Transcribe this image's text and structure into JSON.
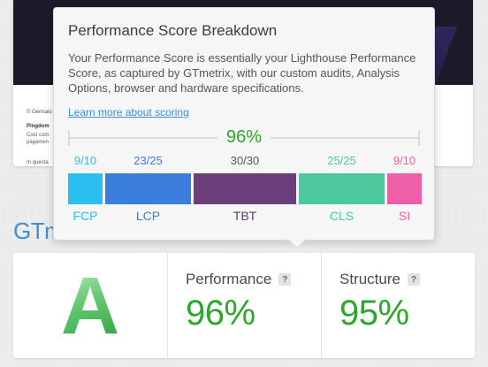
{
  "tooltip": {
    "title": "Performance Score Breakdown",
    "description": "Your Performance Score is essentially your Lighthouse Performance Score, as captured by GTmetrix, with our custom audits, Analysis Options, browser and hardware specifications.",
    "link_label": "Learn more about scoring",
    "total_score": "96%",
    "segments": [
      {
        "key": "fcp",
        "name": "FCP",
        "points": "9/10",
        "color": "#2bbff0",
        "weight": 10,
        "earned": 9
      },
      {
        "key": "lcp",
        "name": "LCP",
        "points": "23/25",
        "color": "#3a7ddb",
        "weight": 25,
        "earned": 23
      },
      {
        "key": "tbt",
        "name": "TBT",
        "points": "30/30",
        "color": "#6b3f7a",
        "weight": 30,
        "earned": 30
      },
      {
        "key": "cls",
        "name": "CLS",
        "points": "25/25",
        "color": "#4ec79d",
        "weight": 25,
        "earned": 25
      },
      {
        "key": "si",
        "name": "SI",
        "points": "9/10",
        "color": "#ef5fa7",
        "weight": 10,
        "earned": 9
      }
    ]
  },
  "brand": {
    "partial_text": "GTm"
  },
  "background_thumb": {
    "lines": [
      "© Gennaio",
      "Pingdom",
      "Così com",
      "pagamen",
      "In questa"
    ]
  },
  "score_card": {
    "grade": "A",
    "performance": {
      "label": "Performance",
      "value": "96%",
      "help": "?"
    },
    "structure": {
      "label": "Structure",
      "value": "95%",
      "help": "?"
    }
  }
}
